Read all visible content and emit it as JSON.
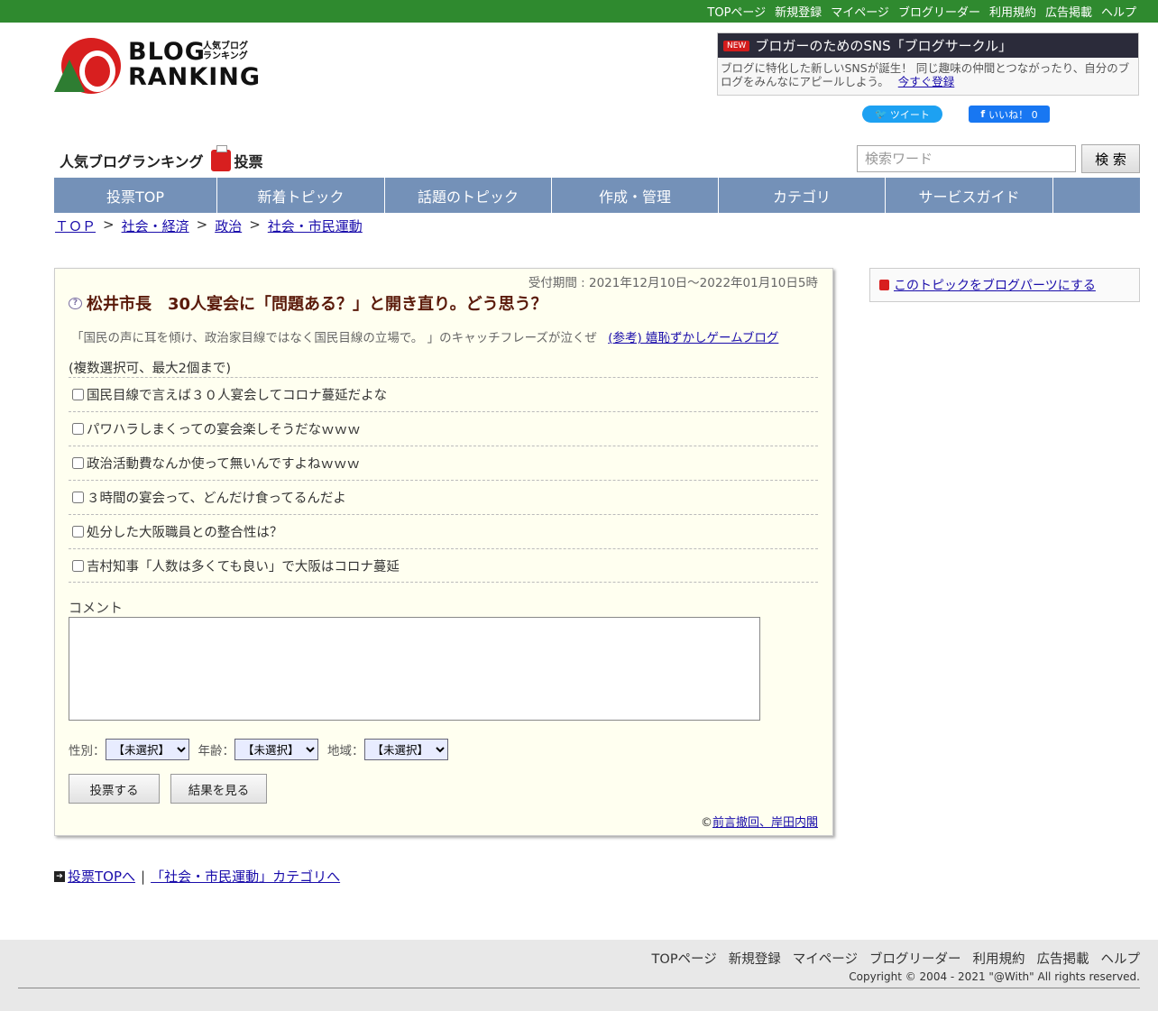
{
  "topbar": [
    "TOPページ",
    "新規登録",
    "マイページ",
    "ブログリーダー",
    "利用規約",
    "広告掲載",
    "ヘルプ"
  ],
  "logo": {
    "line1": "BLOG",
    "line2": "RANKING",
    "jp1": "人気ブログ",
    "jp2": "ランキング"
  },
  "sns_ad": {
    "badge": "NEW",
    "title": "ブロガーのためのSNS「ブログサークル」",
    "body": "ブログに特化した新しいSNSが誕生！ 同じ趣味の仲間とつながったり、自分のブログをみんなにアピールしよう。",
    "link": "今すぐ登録"
  },
  "social": {
    "tweet": "ツイート",
    "like": "いいね！ 0"
  },
  "vote_heading": {
    "left": "人気ブログランキング",
    "right": "投票"
  },
  "search": {
    "placeholder": "検索ワード",
    "button": "検 索"
  },
  "nav": [
    "投票TOP",
    "新着トピック",
    "話題のトピック",
    "作成・管理",
    "カテゴリ",
    "サービスガイド",
    ""
  ],
  "breadcrumb": [
    "ＴＯＰ",
    "社会・経済",
    "政治",
    "社会・市民運動"
  ],
  "topic": {
    "period": "受付期間 : 2021年12月10日～2022年01月10日5時",
    "title": "松井市長　30人宴会に「問題ある？」と開き直り。どう思う？",
    "description": "「国民の声に耳を傾け、政治家目線ではなく国民目線の立場で。 」のキャッチフレーズが泣くぜ",
    "reference_link": "(参考) 嬉恥ずかしゲームブログ",
    "multi_note": "(複数選択可、最大2個まで)",
    "options": [
      "国民目線で言えば３０人宴会してコロナ蔓延だよな",
      "パワハラしまくっての宴会楽しそうだなｗｗｗ",
      "政治活動費なんか使って無いんですよねｗｗｗ",
      "３時間の宴会って、どんだけ食ってるんだよ",
      "処分した大阪職員との整合性は？",
      "吉村知事「人数は多くても良い」で大阪はコロナ蔓延"
    ],
    "comment_label": "コメント",
    "gender_label": "性別：",
    "age_label": "年齢：",
    "region_label": "地域：",
    "unselected": "【未選択】",
    "vote_button": "投票する",
    "result_button": "結果を見る",
    "copyright_prefix": "©",
    "copyright_link": "前言撤回、岸田内閣"
  },
  "side": {
    "parts_link": "このトピックをブログパーツにする"
  },
  "bottom": {
    "top_link": "投票TOPへ",
    "separator": "|",
    "category_link": "「社会・市民運動」カテゴリへ"
  },
  "footer": {
    "nav": [
      "TOPページ",
      "新規登録",
      "マイページ",
      "ブログリーダー",
      "利用規約",
      "広告掲載",
      "ヘルプ"
    ],
    "copyright": "Copyright © 2004 - 2021 \"@With\" All rights reserved."
  },
  "colors": {
    "topbar": "#2f8a2f",
    "nav": "#7491b8",
    "card_bg": "#fffff0",
    "title": "#5a1a0a"
  }
}
